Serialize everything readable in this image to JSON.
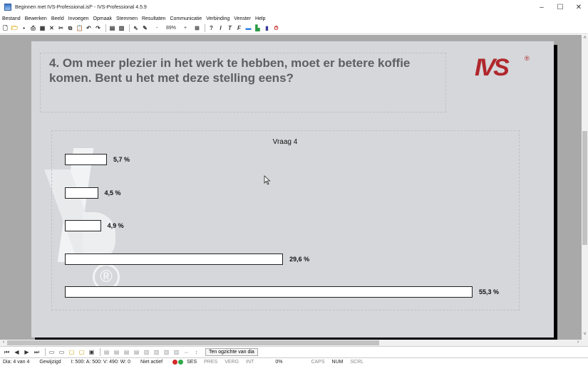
{
  "window": {
    "title": "Beginnen met IVS-Professional.isf* - IVS-Professional 4.5.9",
    "minimize": "–",
    "maximize": "☐",
    "close": "✕"
  },
  "menu": [
    "Bestand",
    "Bewerken",
    "Beeld",
    "Invoegen",
    "Opmaak",
    "Stemmen",
    "Resultaten",
    "Communicatie",
    "Verbinding",
    "Venster",
    "Help"
  ],
  "toolbar": {
    "zoom_minus": "-",
    "zoom": "89%",
    "zoom_plus": "+",
    "bold": "?",
    "italic_i": "I",
    "italic_t": "T",
    "italic_f": "F"
  },
  "slide": {
    "question": "4. Om meer plezier in het werk te hebben, moet er betere koffie komen. Bent u het met deze stelling eens?",
    "logo": "IVS",
    "logo_mark": "®",
    "watermark_mark": "®"
  },
  "chart_data": {
    "type": "bar",
    "orientation": "horizontal",
    "title": "Vraag 4",
    "categories": [
      "",
      "",
      "",
      "",
      ""
    ],
    "values": [
      5.7,
      4.5,
      4.9,
      29.6,
      55.3
    ],
    "labels": [
      "5,7 %",
      "4,5 %",
      "4,9 %",
      "29,6 %",
      "55,3 %"
    ],
    "xlim": [
      0,
      55.3
    ],
    "bar_fill": "#ffffff",
    "bar_stroke": "#222222",
    "grid": false,
    "legend": "none"
  },
  "navigation": {
    "first": "⏮",
    "prev": "◀",
    "next": "▶",
    "last": "⏭",
    "view_button": "Ten ogzichte van dia"
  },
  "status": {
    "slide": "Dia: 4 van 4",
    "modified": "Gewijzigd",
    "counts": "I: 500:  A: 500:  V: 490:  W: 0",
    "activity": "Niet actief",
    "ses": "SES",
    "pres": "PRES",
    "verg": "VERG",
    "int": "INT",
    "percent": "0%",
    "caps": "CAPS",
    "num": "NUM",
    "scrl": "SCRL"
  },
  "colors": {
    "slide_bg": "#d5d7da",
    "logo_red": "#b0272d",
    "question_text": "#5b5e62",
    "workspace_bg": "#a9a9a9"
  }
}
